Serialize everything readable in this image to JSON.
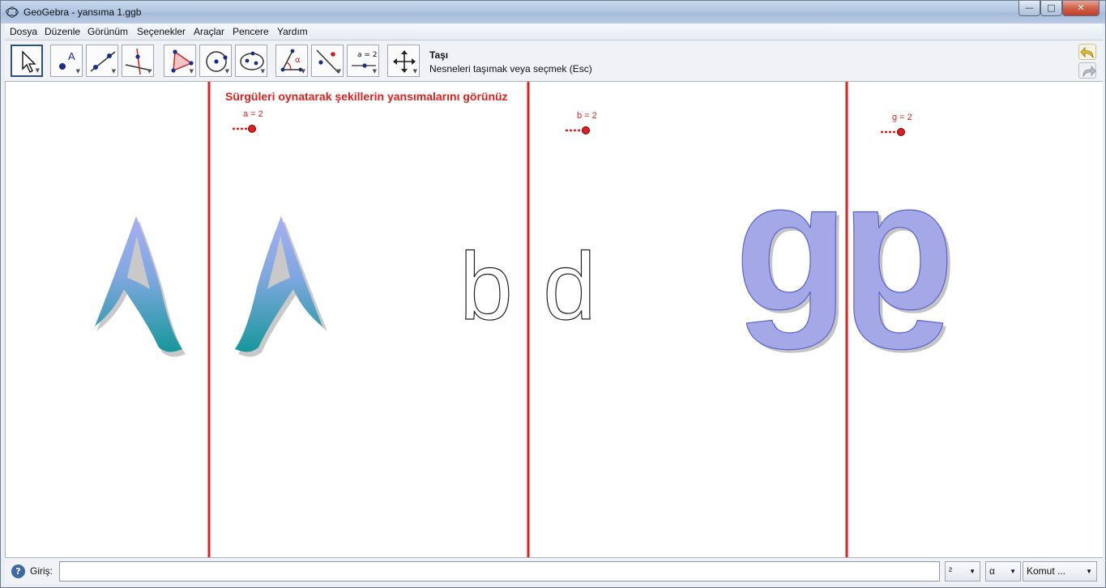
{
  "window": {
    "title": "GeoGebra - yansıma 1.ggb",
    "controls": {
      "minimize": "—",
      "maximize": "□",
      "close": "✕"
    }
  },
  "menu": [
    "Dosya",
    "Düzenle",
    "Görünüm",
    "Seçenekler",
    "Araçlar",
    "Pencere",
    "Yardım"
  ],
  "toolbar": {
    "tools": [
      {
        "name": "move-tool",
        "icon": "arrow-cursor-icon",
        "selected": true
      },
      {
        "name": "point-tool",
        "icon": "new-point-icon"
      },
      {
        "name": "line-tool",
        "icon": "line-through-points-icon"
      },
      {
        "name": "perpendicular-tool",
        "icon": "perpendicular-line-icon"
      },
      {
        "name": "polygon-tool",
        "icon": "polygon-icon"
      },
      {
        "name": "circle-tool",
        "icon": "circle-center-point-icon"
      },
      {
        "name": "conic-tool",
        "icon": "ellipse-icon"
      },
      {
        "name": "angle-tool",
        "icon": "angle-icon",
        "label": "α"
      },
      {
        "name": "reflect-tool",
        "icon": "reflect-about-line-icon"
      },
      {
        "name": "slider-tool",
        "icon": "slider-icon",
        "label": "a = 2"
      },
      {
        "name": "move-graphics-tool",
        "icon": "move-graphics-view-icon"
      }
    ],
    "active_tool_name": "Taşı",
    "active_tool_help": "Nesneleri taşımak veya seçmek (Esc)"
  },
  "graphics": {
    "instruction": "Sürgüleri oynatarak şekillerin yansımalarını görünüz",
    "sliders": [
      {
        "label": "a = 2",
        "value": 2
      },
      {
        "label": "b = 2",
        "value": 2
      },
      {
        "label": "g = 2",
        "value": 2
      }
    ],
    "letters": {
      "a_left": "A",
      "a_right": "A",
      "b_letter": "b",
      "d_letter": "d",
      "g_letter": "g",
      "g_reflected": "g"
    },
    "colors": {
      "mirror_line": "#e02020",
      "slider": "#e02020",
      "letter_a_top": "#9aa6ee",
      "letter_a_bottom": "#1f9c9c",
      "letter_g": "#a4a8e6"
    }
  },
  "inputbar": {
    "label": "Giriş:",
    "value": "",
    "superscript_dropdown": "²",
    "greek_dropdown": "α",
    "command_dropdown": "Komut ..."
  }
}
